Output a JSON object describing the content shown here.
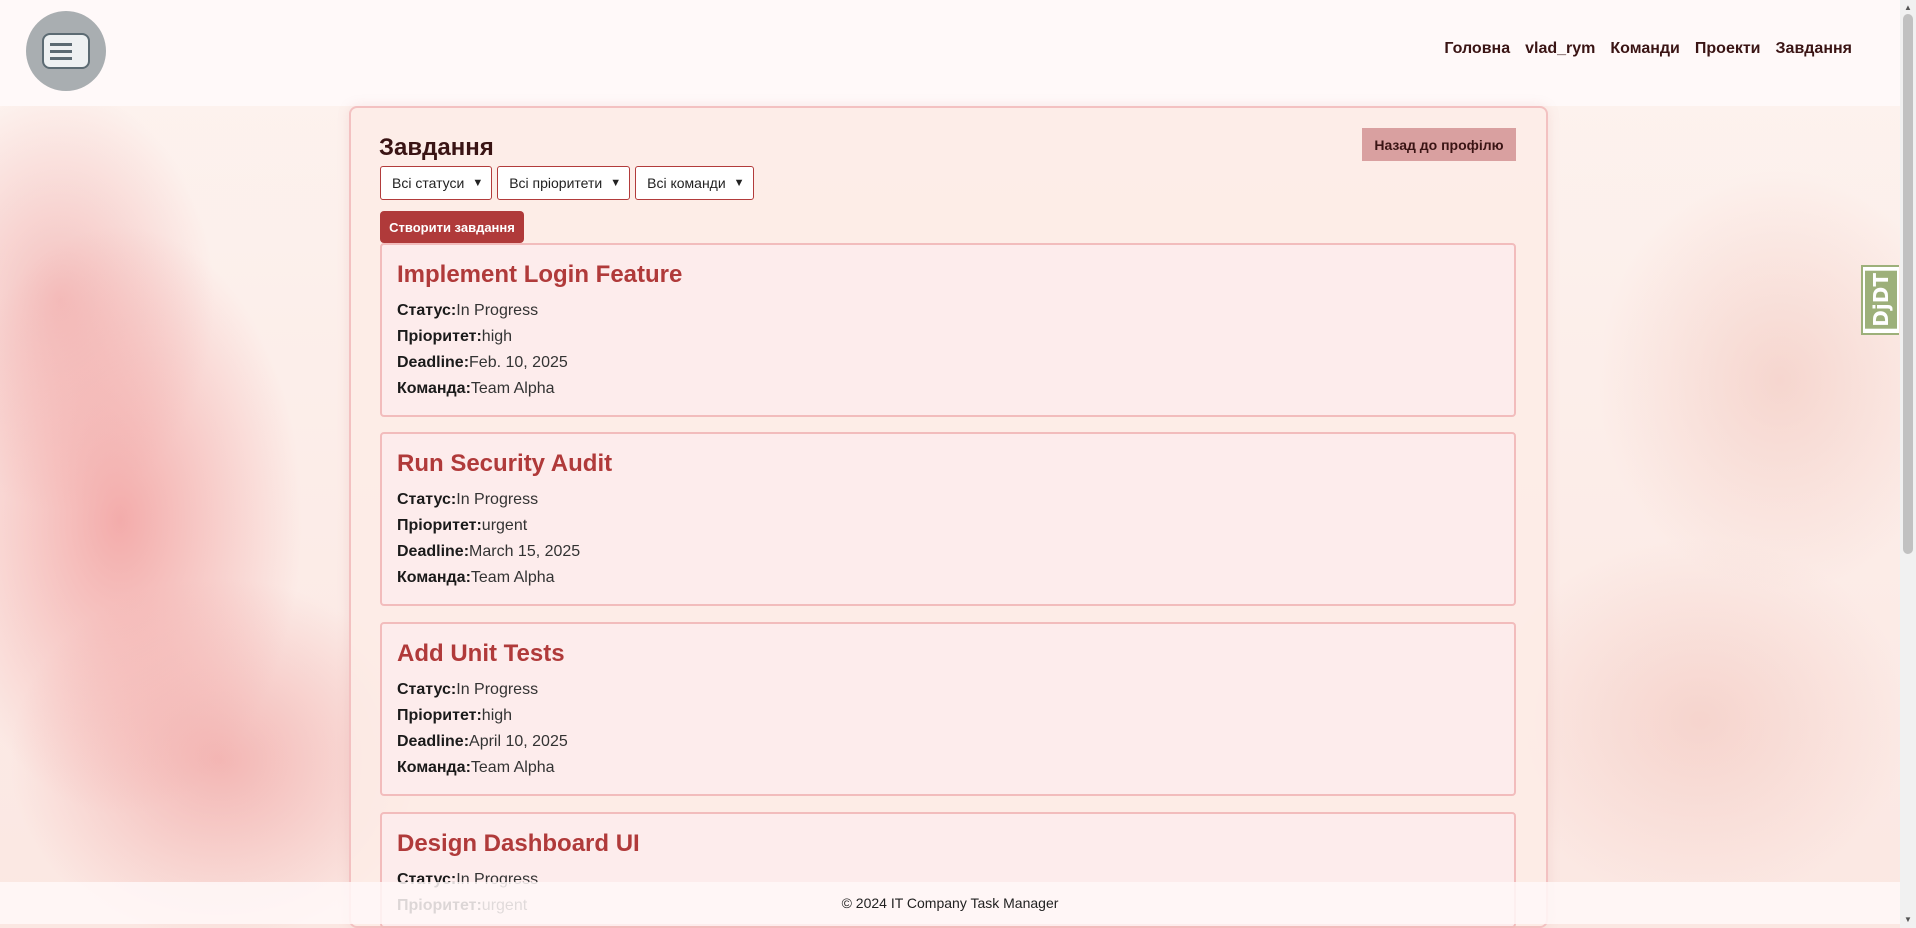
{
  "nav": {
    "items": [
      "Головна",
      "vlad_rym",
      "Команди",
      "Проекти",
      "Завдання"
    ]
  },
  "page": {
    "title": "Завдання",
    "back_label": "Назад до профілю",
    "create_label": "Створити завдання"
  },
  "filters": {
    "status": "Всі статуси",
    "priority": "Всі пріоритети",
    "team": "Всі команди"
  },
  "labels": {
    "status": "Статус:",
    "priority": "Пріоритет:",
    "deadline": "Deadline:",
    "team": "Команда:"
  },
  "tasks": [
    {
      "title": "Implement Login Feature",
      "status": "In Progress",
      "priority": "high",
      "deadline": "Feb. 10, 2025",
      "team": "Team Alpha"
    },
    {
      "title": "Run Security Audit",
      "status": "In Progress",
      "priority": "urgent",
      "deadline": "March 15, 2025",
      "team": "Team Alpha"
    },
    {
      "title": "Add Unit Tests",
      "status": "In Progress",
      "priority": "high",
      "deadline": "April 10, 2025",
      "team": "Team Alpha"
    },
    {
      "title": "Design Dashboard UI",
      "status": "In Progress",
      "priority": "urgent",
      "deadline": "",
      "team": ""
    }
  ],
  "footer": {
    "text": "© 2024 IT Company Task Manager"
  },
  "debug_toolbar": {
    "label": "DjDT"
  },
  "colors": {
    "accent": "#b03a3a",
    "card_bg": "#fdecec",
    "card_border": "#f2bcbc"
  }
}
